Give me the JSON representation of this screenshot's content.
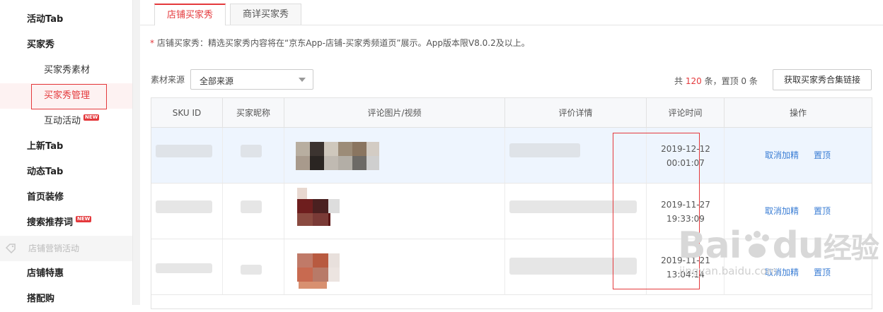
{
  "sidebar": {
    "items": [
      {
        "label": "活动Tab"
      },
      {
        "label": "买家秀"
      },
      {
        "label": "买家秀素材"
      },
      {
        "label": "买家秀管理"
      },
      {
        "label": "互动活动",
        "badge": "NEW"
      },
      {
        "label": "上新Tab"
      },
      {
        "label": "动态Tab"
      },
      {
        "label": "首页装修"
      },
      {
        "label": "搜索推荐词",
        "badge": "NEW"
      },
      {
        "label": "店铺营销活动"
      },
      {
        "label": "店铺特惠"
      },
      {
        "label": "搭配购"
      }
    ]
  },
  "tabs": [
    {
      "label": "店铺买家秀",
      "active": true
    },
    {
      "label": "商详买家秀",
      "active": false
    }
  ],
  "notice": {
    "star": "*",
    "text": "店铺买家秀：精选买家秀内容将在“京东App-店铺-买家秀频道页”展示。App版本限V8.0.2及以上。"
  },
  "filter": {
    "label": "素材来源",
    "selected": "全部来源"
  },
  "summary": {
    "prefix": "共",
    "total": "120",
    "middle": "条，置顶",
    "pinned": "0",
    "suffix": "条"
  },
  "get_link_button": "获取买家秀合集链接",
  "table": {
    "headers": [
      "SKU ID",
      "买家昵称",
      "评论图片/视频",
      "评价详情",
      "评论时间",
      "操作"
    ],
    "rows": [
      {
        "date": "2019-12-12",
        "time": "00:01:07",
        "action1": "取消加精",
        "action2": "置顶"
      },
      {
        "date": "2019-11-27",
        "time": "19:33:09",
        "action1": "取消加精",
        "action2": "置顶"
      },
      {
        "date": "2019-11-21",
        "time": "13:04:14",
        "action1": "取消加精",
        "action2": "置顶"
      }
    ]
  },
  "watermark": {
    "brand": "Bai",
    "du": "du",
    "jingyan": "经验",
    "url": "jingyan.baidu.com"
  },
  "colors": {
    "accent": "#e4393c",
    "link": "#3a7dd4"
  }
}
